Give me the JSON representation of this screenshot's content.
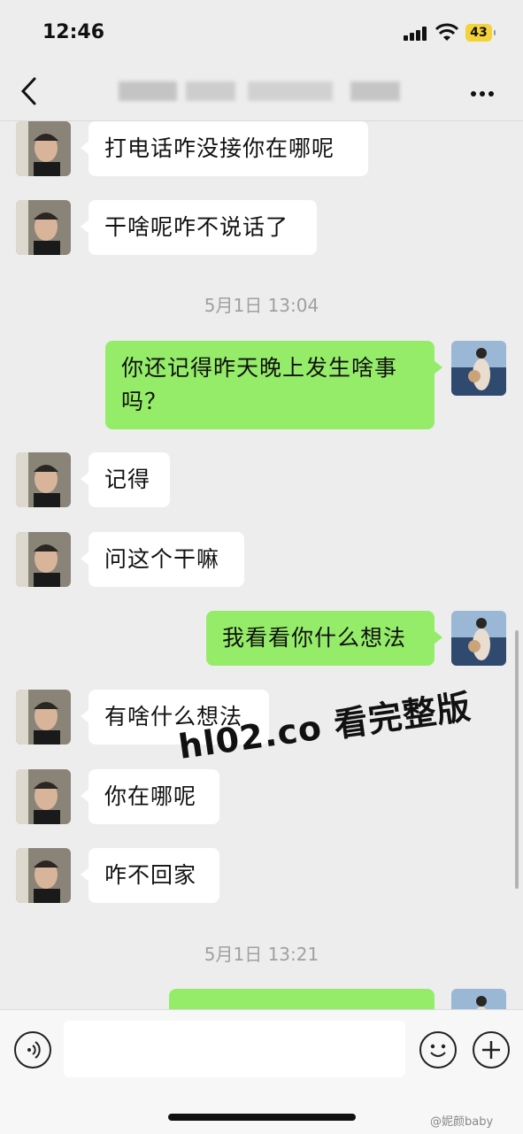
{
  "status": {
    "time": "12:46",
    "battery": "43"
  },
  "header": {
    "back_icon": "chevron-left-icon",
    "more_icon": "more-dots-icon"
  },
  "messages": [
    {
      "side": "in",
      "text": "打电话咋没接你在哪呢"
    },
    {
      "side": "in",
      "text": "干啥呢咋不说话了"
    },
    {
      "timestamp": "5月1日 13:04"
    },
    {
      "side": "out",
      "text": "你还记得昨天晚上发生啥事吗？"
    },
    {
      "side": "in",
      "text": "记得"
    },
    {
      "side": "in",
      "text": "问这个干嘛"
    },
    {
      "side": "out",
      "text": "我看看你什么想法"
    },
    {
      "side": "in",
      "text": "有啥什么想法"
    },
    {
      "side": "in",
      "text": "你在哪呢"
    },
    {
      "side": "in",
      "text": "咋不回家"
    },
    {
      "timestamp": "5月1日 13:21"
    }
  ],
  "watermark": "hl02.co 看完整版",
  "footer": {
    "credit": "@妮颜baby"
  },
  "colors": {
    "background": "#ededed",
    "incoming": "#ffffff",
    "outgoing": "#95ec69"
  }
}
